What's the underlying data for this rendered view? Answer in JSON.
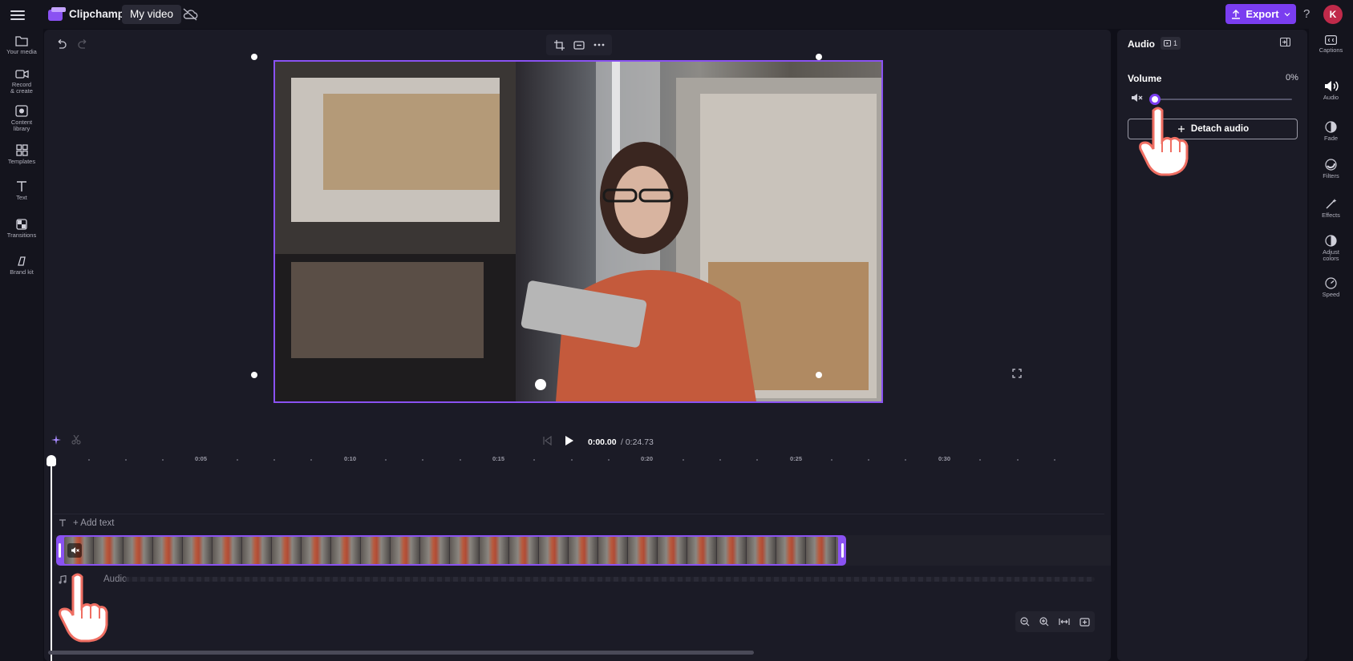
{
  "topbar": {
    "app_name": "Clipchamp",
    "project_name": "My video",
    "export_label": "Export",
    "help": "?",
    "avatar_initial": "K"
  },
  "left_sidebar": {
    "items": [
      {
        "label": "Your media",
        "icon": "folder-icon"
      },
      {
        "label": "Record & create",
        "icon": "camera-icon"
      },
      {
        "label": "Content library",
        "icon": "library-icon"
      },
      {
        "label": "Templates",
        "icon": "templates-icon"
      },
      {
        "label": "Text",
        "icon": "text-icon"
      },
      {
        "label": "Transitions",
        "icon": "transitions-icon"
      },
      {
        "label": "Brand kit",
        "icon": "brand-kit-icon"
      }
    ]
  },
  "timeline": {
    "time_current": "0:00.00",
    "time_total": "/ 0:24.73",
    "ruler_labels": [
      "0:05",
      "0:10",
      "0:15",
      "0:20",
      "0:25",
      "0:30"
    ],
    "add_text_label": "+ Add text",
    "audio_track_label": "Audio"
  },
  "properties": {
    "header": "Audio",
    "badge_count": "1",
    "volume_label": "Volume",
    "volume_value": "0%",
    "volume_fraction": 0,
    "detach_label": "Detach audio"
  },
  "right_rail": {
    "items": [
      {
        "label": "Captions",
        "icon": "captions-icon"
      },
      {
        "label": "Audio",
        "icon": "speaker-icon"
      },
      {
        "label": "Fade",
        "icon": "fade-icon"
      },
      {
        "label": "Filters",
        "icon": "filters-icon"
      },
      {
        "label": "Effects",
        "icon": "effects-icon"
      },
      {
        "label": "Adjust colors",
        "icon": "adjust-colors-icon"
      },
      {
        "label": "Speed",
        "icon": "speed-icon"
      }
    ]
  },
  "colors": {
    "accent": "#7a3df0",
    "highlight": "#ef6e62"
  }
}
